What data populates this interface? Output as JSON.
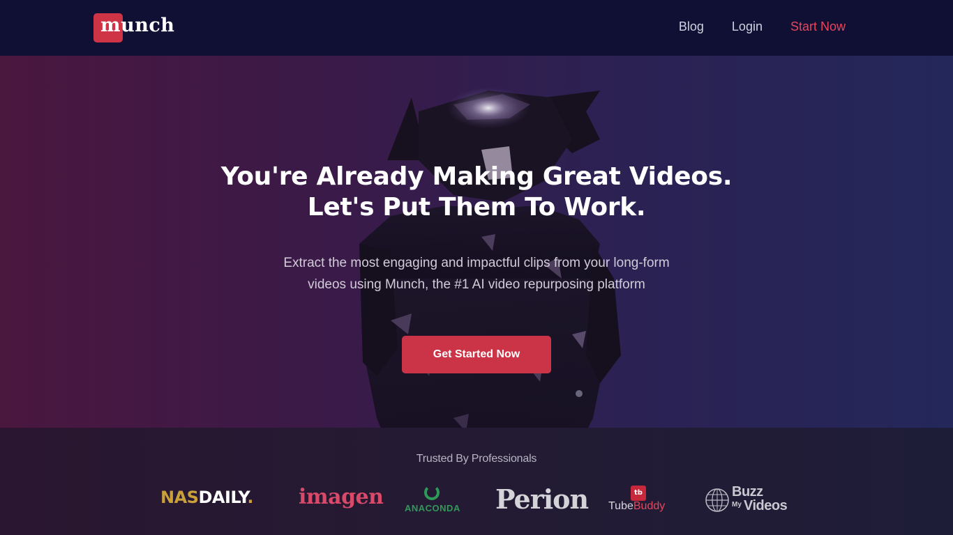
{
  "nav": {
    "logo_text": "munch",
    "links": [
      {
        "label": "Blog"
      },
      {
        "label": "Login"
      },
      {
        "label": "Start Now"
      }
    ]
  },
  "hero": {
    "headline_line1": "You're Already Making Great Videos.",
    "headline_line2": "Let's Put Them To Work.",
    "sub_line1": "Extract the most engaging and impactful clips from your long-form",
    "sub_line2": "videos using Munch, the #1 AI video repurposing platform",
    "cta_label": "Get Started Now",
    "background_image": "armored-figure-with-horns"
  },
  "trusted": {
    "title": "Trusted By Professionals",
    "brands": {
      "nasdaily": {
        "part1": "NAS",
        "part2": "DAILY",
        "dot": "."
      },
      "imagen": "imagen",
      "anaconda": "ANACONDA",
      "perion": "Perion",
      "tubebuddy": {
        "icon": "tb",
        "part1": "Tube",
        "part2": "Buddy"
      },
      "buzzmyvideos": {
        "line1": "Buzz",
        "my": "My",
        "line2": "Videos"
      }
    }
  },
  "colors": {
    "accent": "#cb3346",
    "nav_bg": "#0f1034",
    "accent_link": "#e9455c"
  }
}
